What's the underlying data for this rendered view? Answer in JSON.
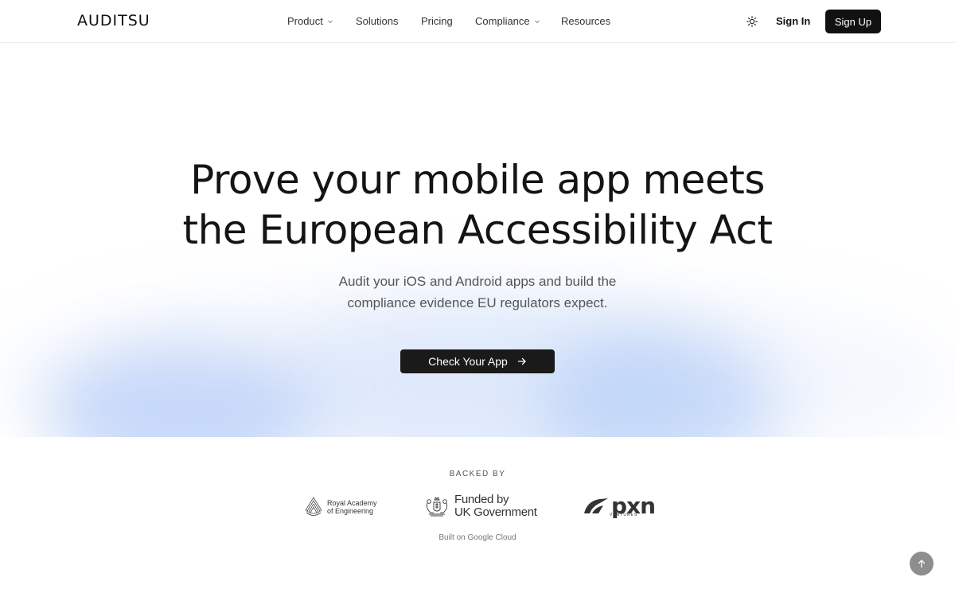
{
  "brand": {
    "logo_text": "AUDITSU"
  },
  "nav": {
    "items": [
      {
        "label": "Product",
        "has_dropdown": true
      },
      {
        "label": "Solutions",
        "has_dropdown": false
      },
      {
        "label": "Pricing",
        "has_dropdown": false
      },
      {
        "label": "Compliance",
        "has_dropdown": true
      },
      {
        "label": "Resources",
        "has_dropdown": false
      }
    ],
    "theme_icon": "sun-icon",
    "sign_in_label": "Sign In",
    "sign_up_label": "Sign Up"
  },
  "hero": {
    "headline_line1": "Prove your mobile app meets",
    "headline_line2": "the European Accessibility Act",
    "subhead_line1": "Audit your iOS and Android apps and build the",
    "subhead_line2": "compliance evidence EU regulators expect.",
    "cta_label": "Check Your App",
    "cta_icon": "arrow-right-icon"
  },
  "backers": {
    "label": "BACKED BY",
    "logos": [
      {
        "name": "Royal Academy of Engineering",
        "line1": "Royal Academy",
        "line2": "of Engineering"
      },
      {
        "name": "Funded by UK Government",
        "line1": "Funded by",
        "line2": "UK Government"
      },
      {
        "name": "pxn ventures",
        "word": "pxn",
        "sub": "VENTURES"
      }
    ],
    "built_on": "Built on Google Cloud"
  },
  "scroll_top_icon": "arrow-up-icon",
  "colors": {
    "primary_dark": "#111111",
    "glow_blue": "#a0bef5",
    "text_muted": "#555555"
  }
}
